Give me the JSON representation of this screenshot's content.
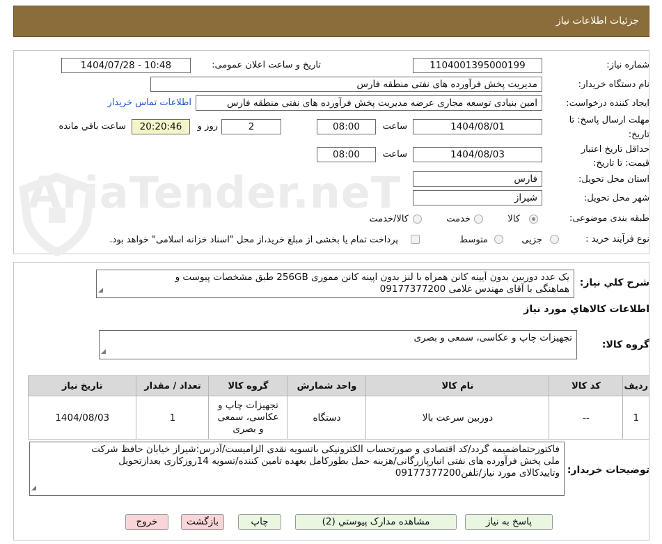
{
  "header": {
    "title": "جزئیات اطلاعات نیاز"
  },
  "watermark": "AriaTender.neT",
  "form": {
    "need_number_label": "شماره نیاز:",
    "need_number": "1104001395000199",
    "announce_label": "تاریخ و ساعت اعلان عمومی:",
    "announce_value": "1404/07/28 - 10:48",
    "buyer_org_label": "نام دستگاه خریدار:",
    "buyer_org": "مدیریت پخش فرآورده های نفتی منطقه فارس",
    "requester_label": "ایجاد کننده درخواست:",
    "requester": "امین بنیادی توسعه مجاری عرضه مدیریت پخش فرآورده های نفتی منطقه فارس",
    "contact_link": "اطلاعات تماس خریدار",
    "deadline_label_1": "مهلت ارسال پاسخ: تا",
    "deadline_label_2": "تاریخ:",
    "deadline_date": "1404/08/01",
    "time_label": "ساعت",
    "deadline_time": "08:00",
    "days_value": "2",
    "days_label": "روز و",
    "remaining_time": "20:20:46",
    "remaining_label": "ساعت باقي مانده",
    "validity_label_1": "حداقل تاریخ اعتبار",
    "validity_label_2": "قیمت: تا تاریخ:",
    "validity_date": "1404/08/03",
    "validity_time": "08:00",
    "province_label": "استان محل تحویل:",
    "province": "فارس",
    "city_label": "شهر محل تحویل:",
    "city": "شیراز",
    "category_label": "طبقه بندی موضوعی:",
    "category_options": [
      "کالا",
      "خدمت",
      "کالا/خدمت"
    ],
    "process_label": "نوع فرآیند خرید :",
    "process_options": [
      "جزیی",
      "متوسط"
    ],
    "payment_note": "پرداخت تمام یا بخشی از مبلغ خرید،از محل \"اسناد خزانه اسلامی\" خواهد بود."
  },
  "summary": {
    "label": "شرح کلي نياز:",
    "line1": "یک عدد دوربین بدون آیینه کانن همراه با لنز بدون اپینه کانن  مموری 256GB طبق مشخصات پیوست و",
    "line2": "هماهنگی با آقای مهندس غلامی 09177377200"
  },
  "goods_info": {
    "title": "اطلاعات کالاهاي مورد نياز",
    "group_label": "گروه کالا:",
    "group_value": "تجهیزات چاپ و عکاسی، سمعی و بصری"
  },
  "table": {
    "headers": [
      "ردیف",
      "کد کالا",
      "نام کالا",
      "واحد شمارش",
      "گروه کالا",
      "تعداد / مقدار",
      "تاریخ نیاز"
    ],
    "rows": [
      {
        "row": "1",
        "code": "--",
        "name": "دوربین سرعت بالا",
        "unit": "دستگاه",
        "group_l1": "تجهیزات چاپ و",
        "group_l2": "عکاسی، سمعی",
        "group_l3": "و بصری",
        "qty": "1",
        "date": "1404/08/03"
      }
    ]
  },
  "buyer_notes": {
    "label": "توضیحات خریدار:",
    "line1": "فاکتورحتماضمیمه گردد/کد اقتصادی و صورتحساب الکترونیکی باتسویه نقدی الزامیست/آدرس:شیراز خیابان حافظ شرکت",
    "line2": "ملی پخش فرآورده های نفتی انبارپازرگانی/هزینه حمل بطورکامل بعهده تامین کننده/تسویه 14روزکاری بعدازتحویل",
    "line3": "وتاییدکالای مورد نیاز/تلفن09177377200"
  },
  "buttons": {
    "reply": "پاسخ به نیاز",
    "attachments": "مشاهده مدارک پیوستي (2)",
    "print": "چاپ",
    "back": "بازگشت",
    "exit": "خروج"
  }
}
